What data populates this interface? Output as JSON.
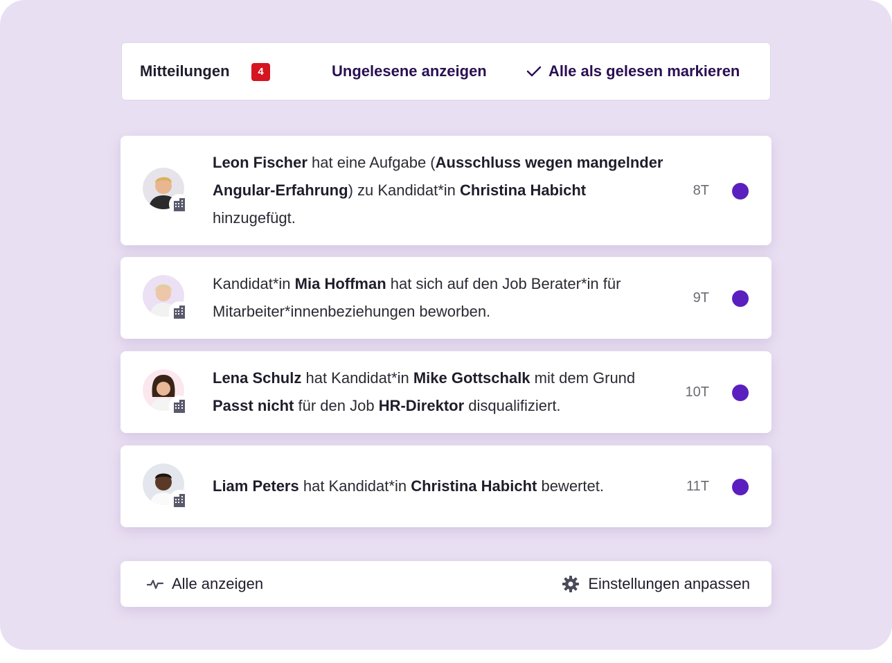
{
  "header": {
    "title": "Mitteilungen",
    "badge_count": "4",
    "show_unread": "Ungelesene anzeigen",
    "mark_all_read": "Alle als gelesen markieren"
  },
  "notifications": [
    {
      "parts": [
        {
          "b": "Leon Fischer"
        },
        {
          "t": " hat eine Aufgabe ("
        },
        {
          "b": "Ausschluss wegen mangelnder Angular-Erfahrung"
        },
        {
          "t": ") zu Kandidat*in "
        },
        {
          "b": "Christina Habicht"
        },
        {
          "t": " hinzugefügt."
        }
      ],
      "time": "8T",
      "avatar_icon": "person-avatar",
      "unread": true
    },
    {
      "parts": [
        {
          "t": "Kandidat*in "
        },
        {
          "b": "Mia Hoffman"
        },
        {
          "t": " hat sich auf den Job Berater*in für Mitarbeiter*innenbeziehungen beworben."
        }
      ],
      "time": "9T",
      "avatar_icon": "person-avatar",
      "unread": true
    },
    {
      "parts": [
        {
          "b": "Lena Schulz"
        },
        {
          "t": " hat Kandidat*in "
        },
        {
          "b": "Mike Gottschalk"
        },
        {
          "t": " mit dem Grund "
        },
        {
          "b": "Passt nicht"
        },
        {
          "t": " für den Job "
        },
        {
          "b": "HR-Direktor"
        },
        {
          "t": " disqualifiziert."
        }
      ],
      "time": "10T",
      "avatar_icon": "person-avatar",
      "unread": true
    },
    {
      "parts": [
        {
          "b": "Liam Peters"
        },
        {
          "t": " hat Kandidat*in "
        },
        {
          "b": "Christina Habicht"
        },
        {
          "t": " bewertet."
        }
      ],
      "time": "11T",
      "avatar_icon": "person-avatar",
      "unread": true
    }
  ],
  "footer": {
    "show_all": "Alle anzeigen",
    "show_all_icon": "activity-icon",
    "settings": "Einstellungen anpassen",
    "settings_icon": "gear-icon"
  },
  "colors": {
    "background": "#e9dff2",
    "accent_link": "#2a0f52",
    "badge": "#d5151f",
    "unread_dot": "#5b1fbf"
  }
}
